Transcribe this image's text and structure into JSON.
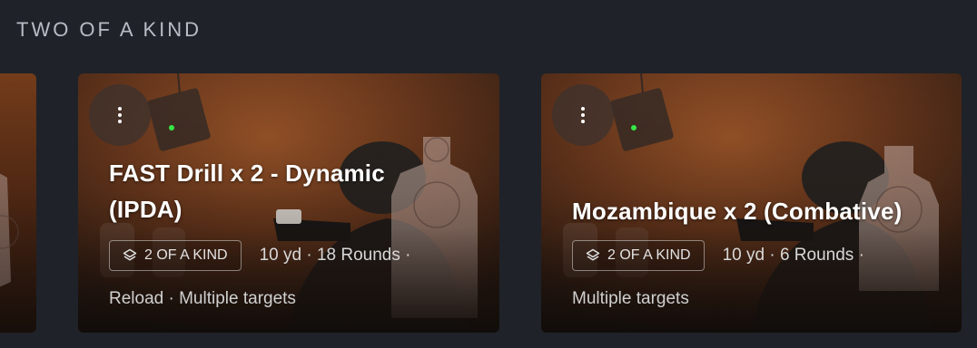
{
  "section": {
    "title": "TWO OF A KIND"
  },
  "cards": [
    {
      "title_line1": "FAST Drill x 2 - Dynamic",
      "title_line2": "(IPDA)",
      "badge": "2 OF A KIND",
      "meta": "10 yd · 18 Rounds ·",
      "tags": "Reload · Multiple targets",
      "menu_icon": "more-vertical-icon",
      "badge_icon": "layers-icon"
    },
    {
      "title_line1": "Mozambique x 2 (Combative)",
      "title_line2": "",
      "badge": "2 OF A KIND",
      "meta": "10 yd · 6 Rounds ·",
      "tags": "Multiple targets",
      "menu_icon": "more-vertical-icon",
      "badge_icon": "layers-icon"
    }
  ],
  "colors": {
    "background": "#1f2229",
    "card_warm": "#8a4a22"
  }
}
